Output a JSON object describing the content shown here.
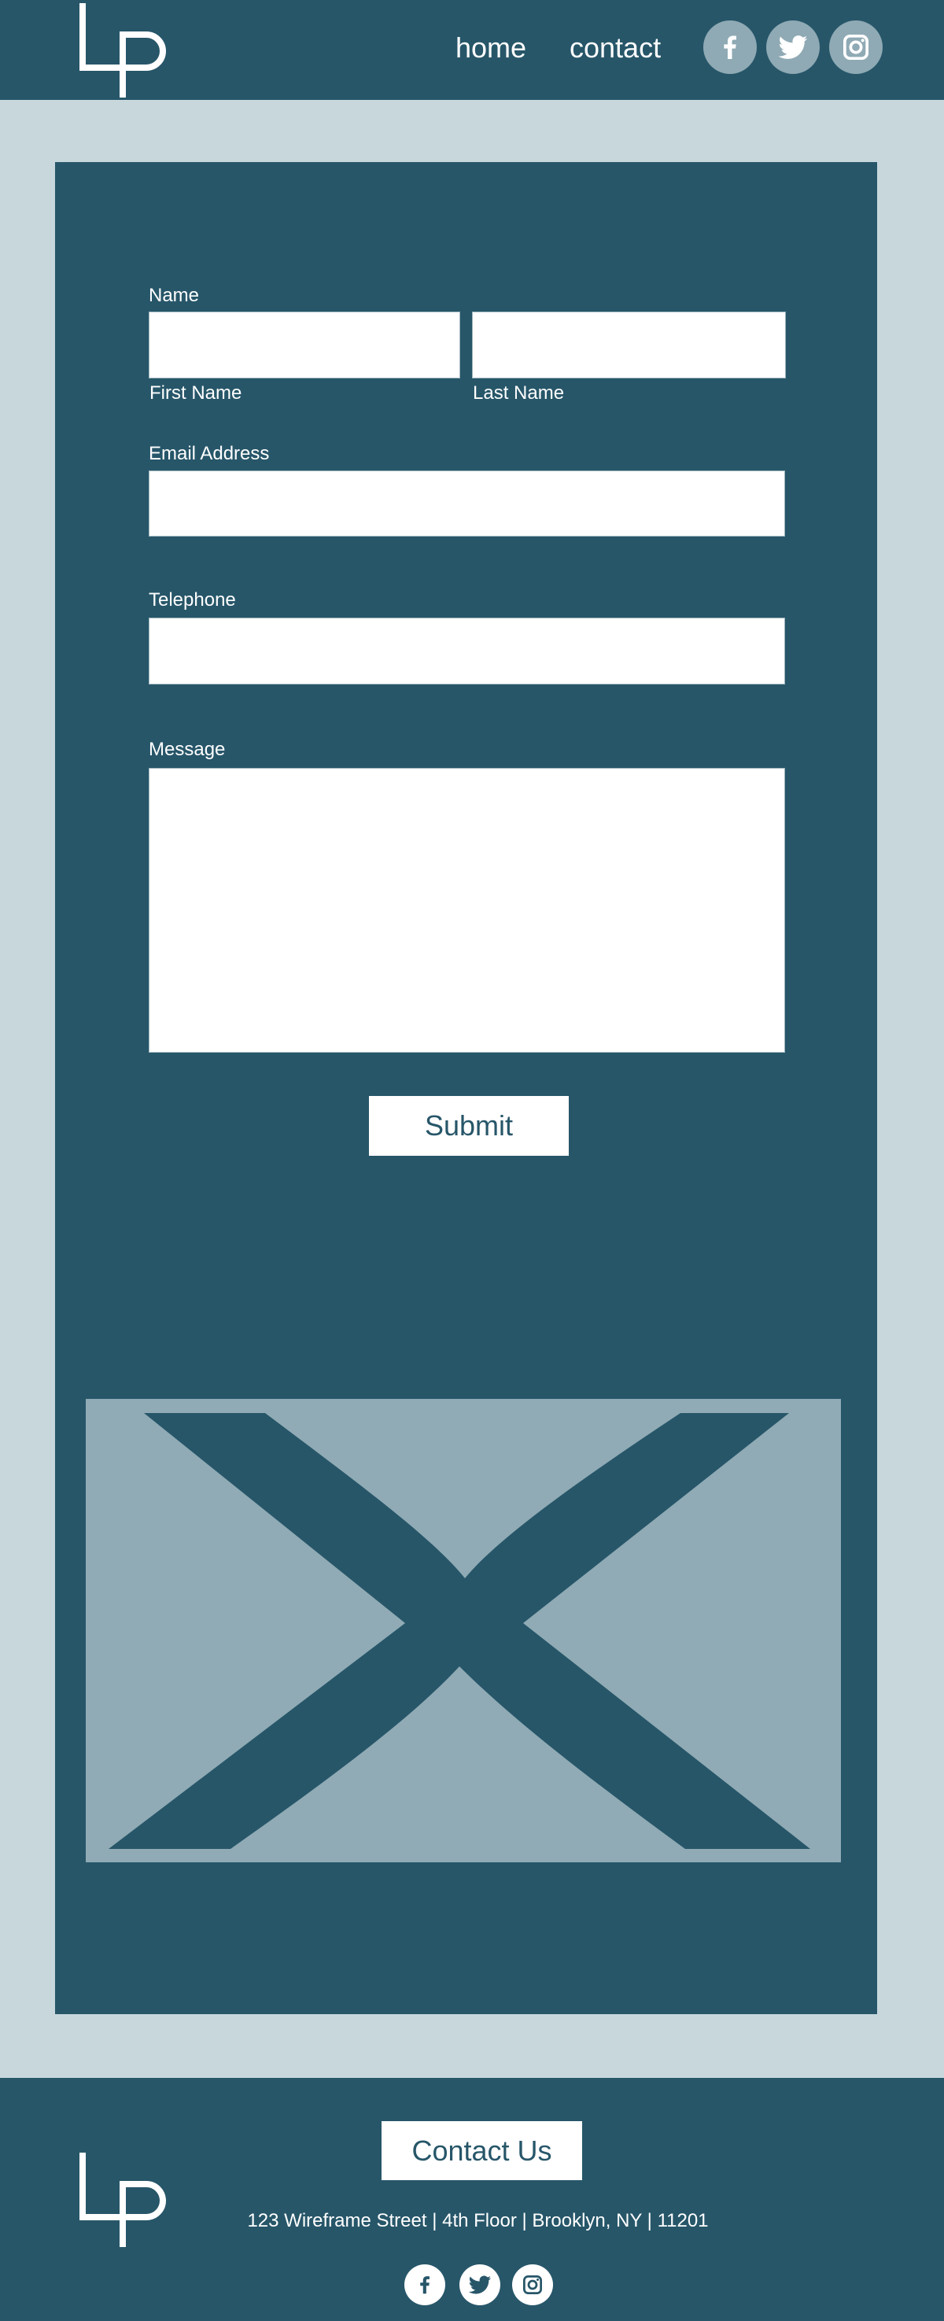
{
  "header": {
    "logo_text": "LP",
    "nav": [
      {
        "label": "home"
      },
      {
        "label": "contact"
      }
    ],
    "social": [
      "facebook-icon",
      "twitter-icon",
      "instagram-icon"
    ]
  },
  "form": {
    "name_label": "Name",
    "first_name_label": "First Name",
    "first_name_value": "",
    "last_name_label": "Last Name",
    "last_name_value": "",
    "email_label": "Email Address",
    "email_value": "",
    "telephone_label": "Telephone",
    "telephone_value": "",
    "message_label": "Message",
    "message_value": "",
    "submit_label": "Submit"
  },
  "image_placeholder": {
    "icon": "image-placeholder-x"
  },
  "footer": {
    "logo_text": "LP",
    "contact_button_label": "Contact Us",
    "address": "123 Wireframe Street | 4th Floor | Brooklyn, NY | 11201",
    "social": [
      "facebook-icon",
      "twitter-icon",
      "instagram-icon"
    ]
  },
  "colors": {
    "primary": "#275669",
    "background": "#c7d7dc",
    "social_circle": "#8faab4",
    "placeholder": "#90abb5",
    "white": "#ffffff"
  }
}
